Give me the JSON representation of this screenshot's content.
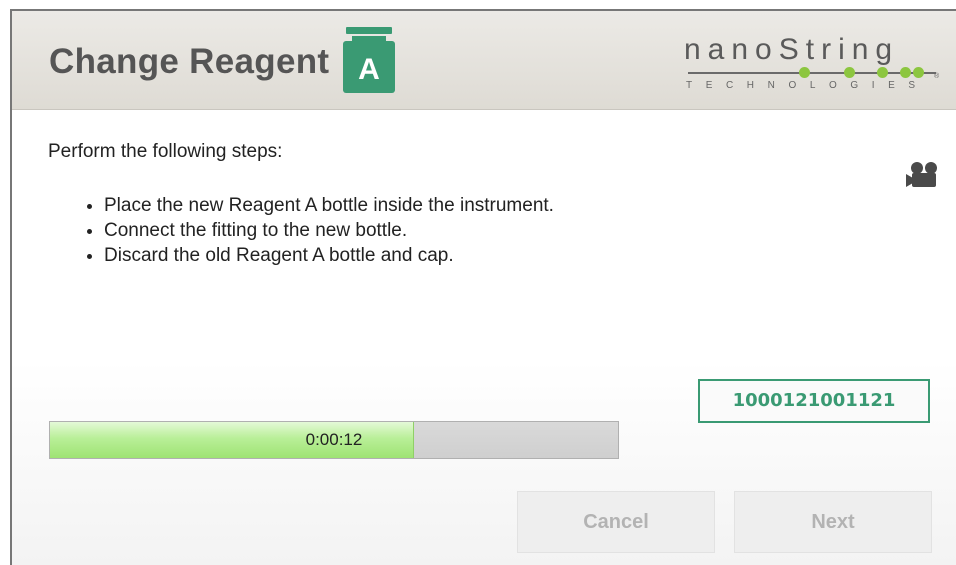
{
  "header": {
    "title": "Change Reagent",
    "reagent_letter": "A",
    "logo_word": "nanoString",
    "logo_sub": "TECHNOLOGIES",
    "logo_reg": "®"
  },
  "instructions": {
    "intro": "Perform the following steps:",
    "steps": [
      "Place the new Reagent A bottle inside the instrument.",
      "Connect the fitting to the new bottle.",
      "Discard the old Reagent A bottle and cap."
    ]
  },
  "video_icon": "video-camera-icon",
  "lot_code": "1000121001121",
  "progress": {
    "time": "0:00:12",
    "fraction": 0.64
  },
  "buttons": {
    "cancel": "Cancel",
    "next": "Next"
  },
  "colors": {
    "accent_green": "#3a9a73",
    "progress_green": "#b9ef98",
    "logo_dot_green": "#8cc63f"
  }
}
